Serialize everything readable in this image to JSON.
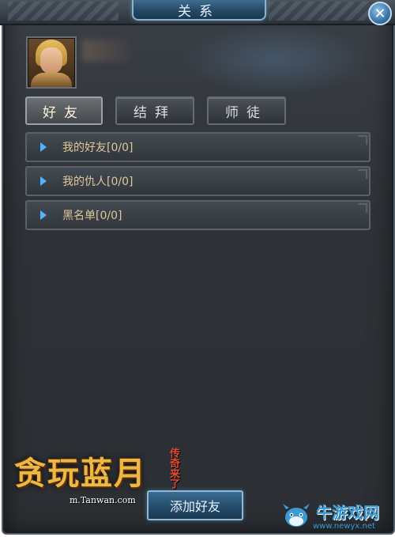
{
  "window": {
    "title": "关系",
    "close_label": "✕"
  },
  "tabs": [
    {
      "label": "好友",
      "active": true
    },
    {
      "label": "结拜",
      "active": false
    },
    {
      "label": "师徒",
      "active": false
    }
  ],
  "list": [
    {
      "label": "我的好友[0/0]"
    },
    {
      "label": "我的仇人[0/0]"
    },
    {
      "label": "黑名单[0/0]"
    }
  ],
  "add_friend_button": "添加好友",
  "logo": {
    "main": "贪玩蓝月",
    "side": "传奇来了",
    "url": "m.Tanwan.com"
  },
  "watermark": {
    "name": "牛游戏网",
    "url": "www.newyx.net"
  },
  "colors": {
    "accent_blue": "#4fb4ff",
    "list_text": "#e2c69a",
    "panel_bg": "#2f3338"
  }
}
